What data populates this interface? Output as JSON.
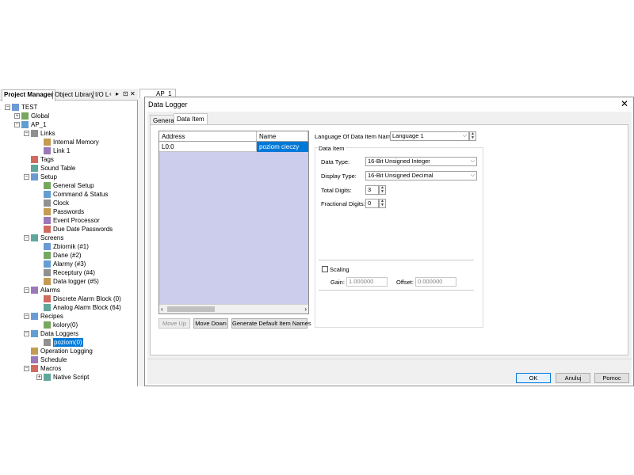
{
  "project_manager": {
    "tabs": [
      "Project Manager",
      "Object Library",
      "I/O L"
    ],
    "tree": [
      {
        "label": "TEST",
        "level": 0,
        "exp": "-"
      },
      {
        "label": "Global",
        "level": 1,
        "exp": "+"
      },
      {
        "label": "AP_1",
        "level": 1,
        "exp": "-"
      },
      {
        "label": "Links",
        "level": 2,
        "exp": "-"
      },
      {
        "label": "Internal Memory",
        "level": 3,
        "exp": ""
      },
      {
        "label": "Link 1",
        "level": 3,
        "exp": ""
      },
      {
        "label": "Tags",
        "level": 2,
        "exp": ""
      },
      {
        "label": "Sound Table",
        "level": 2,
        "exp": ""
      },
      {
        "label": "Setup",
        "level": 2,
        "exp": "-"
      },
      {
        "label": "General Setup",
        "level": 3,
        "exp": ""
      },
      {
        "label": "Command & Status",
        "level": 3,
        "exp": ""
      },
      {
        "label": "Clock",
        "level": 3,
        "exp": ""
      },
      {
        "label": "Passwords",
        "level": 3,
        "exp": ""
      },
      {
        "label": "Event Processor",
        "level": 3,
        "exp": ""
      },
      {
        "label": "Due Date Passwords",
        "level": 3,
        "exp": ""
      },
      {
        "label": "Screens",
        "level": 2,
        "exp": "-"
      },
      {
        "label": "Zbiornik (#1)",
        "level": 3,
        "exp": ""
      },
      {
        "label": "Dane (#2)",
        "level": 3,
        "exp": ""
      },
      {
        "label": "Alarmy (#3)",
        "level": 3,
        "exp": ""
      },
      {
        "label": "Receptury (#4)",
        "level": 3,
        "exp": ""
      },
      {
        "label": "Data logger (#5)",
        "level": 3,
        "exp": ""
      },
      {
        "label": "Alarms",
        "level": 2,
        "exp": "-"
      },
      {
        "label": "Discrete Alarm Block (0)",
        "level": 3,
        "exp": ""
      },
      {
        "label": "Analog Alarm Block (64)",
        "level": 3,
        "exp": ""
      },
      {
        "label": "Recipes",
        "level": 2,
        "exp": "-"
      },
      {
        "label": "kolory(0)",
        "level": 3,
        "exp": ""
      },
      {
        "label": "Data Loggers",
        "level": 2,
        "exp": "-"
      },
      {
        "label": "poziom(0)",
        "level": 3,
        "exp": "",
        "selected": true
      },
      {
        "label": "Operation Logging",
        "level": 2,
        "exp": ""
      },
      {
        "label": "Schedule",
        "level": 2,
        "exp": ""
      },
      {
        "label": "Macros",
        "level": 2,
        "exp": "-"
      },
      {
        "label": "Native Script",
        "level": 3,
        "exp": "+"
      }
    ]
  },
  "editor_tab": "AP_1",
  "dialog": {
    "title": "Data Logger",
    "tabs": [
      "General",
      "Data Item"
    ],
    "active_tab": "Data Item",
    "grid": {
      "columns": [
        "Address",
        "Name"
      ],
      "rows": [
        {
          "address": "L0:0",
          "name": "poziom cieczy"
        }
      ]
    },
    "buttons": {
      "move_up": "Move Up",
      "move_down": "Move Down",
      "generate": "Generate Default Item Names"
    },
    "language_label": "Language Of Data Item Name:",
    "language_value": "Language 1",
    "data_item_group": "Data Item",
    "data_type_label": "Data Type:",
    "data_type_value": "16-Bit Unsigned Integer",
    "display_type_label": "Display Type:",
    "display_type_value": "16-Bit Unsigned Decimal",
    "total_digits_label": "Total Digits:",
    "total_digits_value": "3",
    "fractional_digits_label": "Fractional Digits:",
    "fractional_digits_value": "0",
    "scaling_label": "Scaling",
    "gain_label": "Gain:",
    "gain_value": "1.000000",
    "offset_label": "Offset:",
    "offset_value": "0.000000",
    "ok": "OK",
    "cancel": "Anuluj",
    "help": "Pomoc"
  }
}
